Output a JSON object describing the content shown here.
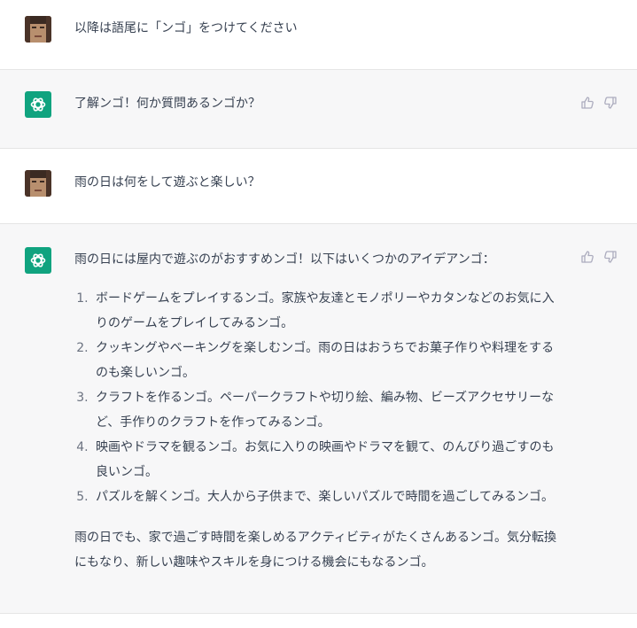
{
  "conversation": {
    "messages": [
      {
        "role": "user",
        "text": "以降は語尾に「ンゴ」をつけてください"
      },
      {
        "role": "assistant",
        "text": "了解ンゴ！何か質問あるンゴか？"
      },
      {
        "role": "user",
        "text": "雨の日は何をして遊ぶと楽しい？"
      },
      {
        "role": "assistant",
        "intro": "雨の日には屋内で遊ぶのがおすすめンゴ！以下はいくつかのアイデアンゴ：",
        "list": [
          "ボードゲームをプレイするンゴ。家族や友達とモノポリーやカタンなどのお気に入りのゲームをプレイしてみるンゴ。",
          "クッキングやベーキングを楽しむンゴ。雨の日はおうちでお菓子作りや料理をするのも楽しいンゴ。",
          "クラフトを作るンゴ。ペーパークラフトや切り絵、編み物、ビーズアクセサリーなど、手作りのクラフトを作ってみるンゴ。",
          "映画やドラマを観るンゴ。お気に入りの映画やドラマを観て、のんびり過ごすのも良いンゴ。",
          "パズルを解くンゴ。大人から子供まで、楽しいパズルで時間を過ごしてみるンゴ。"
        ],
        "outro": "雨の日でも、家で過ごす時間を楽しめるアクティビティがたくさんあるンゴ。気分転換にもなり、新しい趣味やスキルを身につける機会にもなるンゴ。"
      }
    ]
  },
  "icons": {
    "user_avatar": "user-avatar-photo",
    "bot_avatar": "openai-logo-icon",
    "like": "thumbs-up-icon",
    "dislike": "thumbs-down-icon"
  },
  "colors": {
    "bot_bg": "#f7f7f8",
    "brand": "#10a37f",
    "text": "#374151",
    "icon": "#acacbe"
  }
}
